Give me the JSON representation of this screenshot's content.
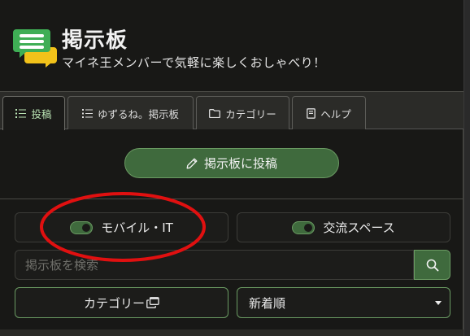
{
  "header": {
    "title": "掲示板",
    "subtitle": "マイネ王メンバーで気軽に楽しくおしゃべり！",
    "logo_icon": "chat-bubbles-icon"
  },
  "tabs": [
    {
      "label": "投稿",
      "icon": "list-icon",
      "active": true
    },
    {
      "label": "ゆずるね。掲示板",
      "icon": "list-icon",
      "active": false
    },
    {
      "label": "カテゴリー",
      "icon": "folder-icon",
      "active": false
    },
    {
      "label": "ヘルプ",
      "icon": "book-icon",
      "active": false
    }
  ],
  "post_button": {
    "label": "掲示板に投稿",
    "icon": "pencil-icon"
  },
  "category_toggles": [
    {
      "label": "モバイル・IT",
      "on": true
    },
    {
      "label": "交流スペース",
      "on": true
    }
  ],
  "search": {
    "placeholder": "掲示板を検索",
    "value": "",
    "icon": "search-icon"
  },
  "category_button": {
    "label": "カテゴリー",
    "icon": "external-window-icon"
  },
  "sort": {
    "selected": "新着順"
  },
  "colors": {
    "accent_green": "#3f6a3d",
    "accent_border": "#6a9a62",
    "background": "#181816",
    "annotation_red": "#e01010"
  }
}
